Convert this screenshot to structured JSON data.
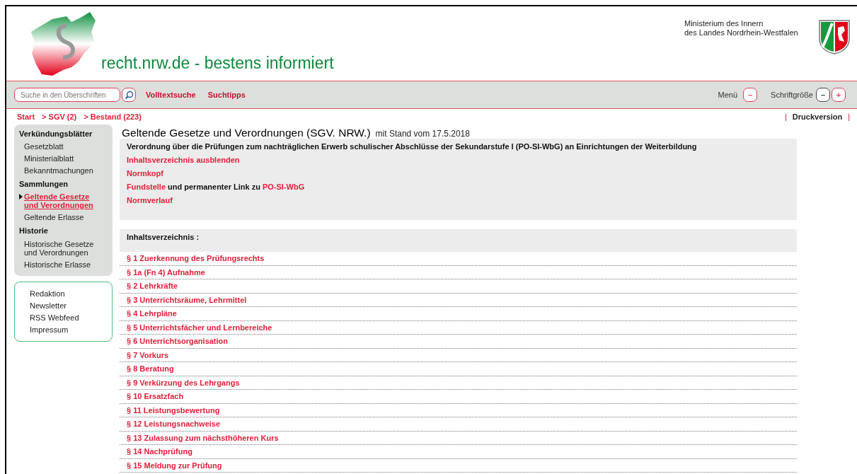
{
  "header": {
    "site_title": "recht.nrw.de - bestens informiert",
    "ministry": [
      "Ministerium des Innern",
      "des Landes Nordrhein-Westfalen"
    ]
  },
  "toolbar": {
    "search": {
      "placeholder": "Suche in den Überschriften"
    },
    "links": [
      "Volltextsuche",
      "Suchtipps"
    ],
    "menu_label": "Menü",
    "menu_button": "–",
    "font_size_label": "Schriftgröße",
    "font_buttons": [
      "–",
      "+"
    ]
  },
  "breadcrumb": [
    "Start",
    "> SGV (2)",
    "> Bestand (223)"
  ],
  "print_link": {
    "left_separator": "|",
    "label": "Druckversion",
    "right_separator": "|"
  },
  "sidebar": {
    "sections": [
      {
        "heading": "Verkündungsblätter",
        "items": [
          {
            "label": "Gesetzblatt",
            "selected": false
          },
          {
            "label": "Ministerialblatt",
            "selected": false
          },
          {
            "label": "Bekanntmachungen",
            "selected": false
          }
        ]
      },
      {
        "heading": "Sammlungen",
        "items": [
          {
            "label": "Geltende Gesetze und Verordnungen",
            "selected": true
          },
          {
            "label": "Geltende Erlasse",
            "selected": false
          }
        ]
      },
      {
        "heading": "Historie",
        "items": [
          {
            "label": "Historische Gesetze und Verordnungen",
            "selected": false
          },
          {
            "label": "Historische Erlasse",
            "selected": false
          }
        ]
      }
    ],
    "service_links": [
      "Redaktion",
      "Newsletter",
      "RSS Webfeed",
      "Impressum"
    ]
  },
  "main": {
    "title": "Geltende Gesetze und Verordnungen (SGV. NRW.)",
    "date_note": "mit Stand vom 17.5.2018",
    "law_title": "Verordnung über die Prüfungen zum nachträglichen Erwerb schulischer Abschlüsse der Sekundarstufe I (PO-SI-WbG) an Einrichtungen der Weiterbildung",
    "info_lines": [
      [
        {
          "kind": "link",
          "text": "Inhaltsverzeichnis ausblenden"
        }
      ],
      [
        {
          "kind": "link",
          "text": "Normkopf"
        }
      ],
      [
        {
          "kind": "link",
          "text": "Fundstelle"
        },
        {
          "kind": "text",
          "text": " und permanenter Link zu "
        },
        {
          "kind": "link",
          "text": "PO-SI-WbG"
        }
      ],
      [
        {
          "kind": "link",
          "text": "Normverlauf"
        }
      ]
    ],
    "toc_heading": "Inhaltsverzeichnis :",
    "toc": [
      "§ 1 Zuerkennung des Prüfungsrechts",
      "§ 1a (Fn 4) Aufnahme",
      "§ 2 Lehrkräfte",
      "§ 3 Unterrichtsräume, Lehrmittel",
      "§ 4 Lehrpläne",
      "§ 5 Unterrichtsfächer und Lernbereiche",
      "§ 6 Unterrichtsorganisation",
      "§ 7 Vorkurs",
      "§ 8 Beratung",
      "§ 9 Verkürzung des Lehrgangs",
      "§ 10 Ersatzfach",
      "§ 11 Leistungsbewertung",
      "§ 12 Leistungsnachweise",
      "§ 13 Zulassung zum nächsthöheren Kurs",
      "§ 14 Nachprüfung",
      "§ 15 Meldung zur Prüfung"
    ]
  }
}
